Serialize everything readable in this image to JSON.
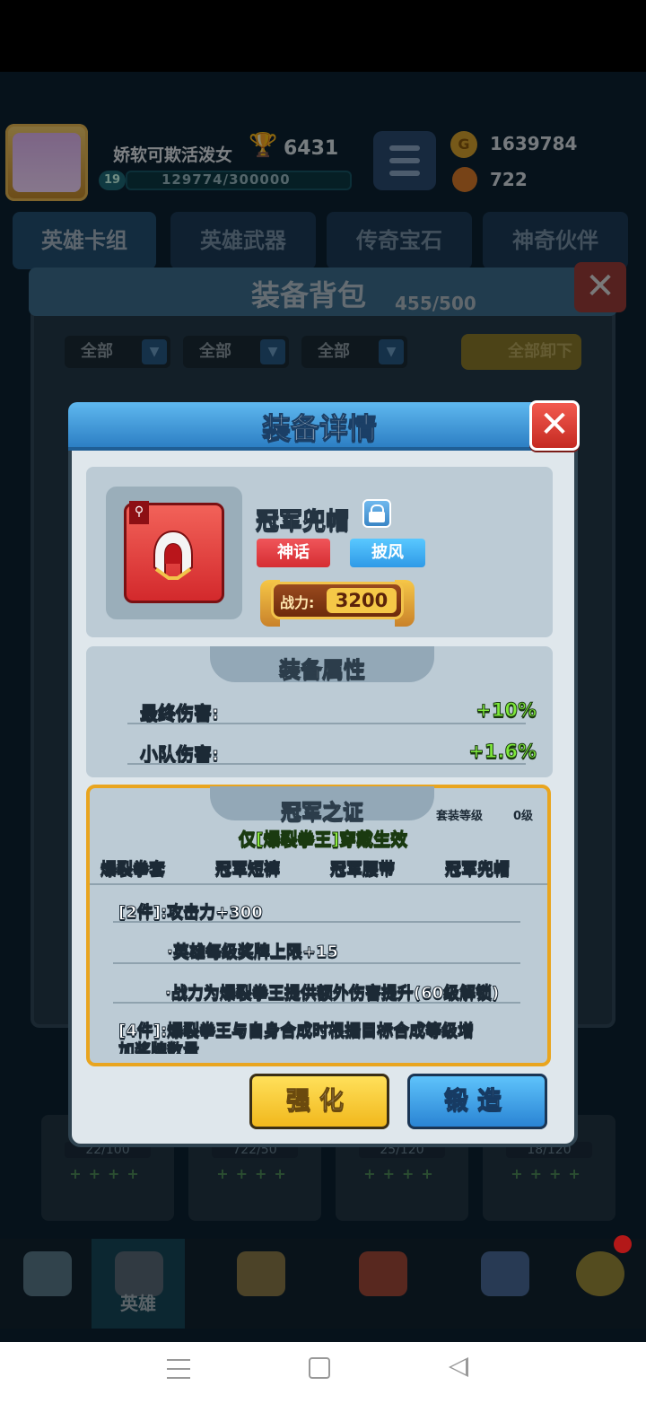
{
  "header": {
    "player_name": "娇软可欺活泼女",
    "trophies": "6431",
    "level": "19",
    "xp": "129774/300000",
    "coins": "1639784",
    "gems": "722"
  },
  "tabs": [
    {
      "label": "英雄卡组"
    },
    {
      "label": "英雄武器"
    },
    {
      "label": "传奇宝石"
    },
    {
      "label": "神奇伙伴"
    }
  ],
  "inventory": {
    "title": "装备背包",
    "count": "455/500",
    "filters": [
      "全部",
      "全部",
      "全部"
    ],
    "unequip_all": "全部卸下"
  },
  "cards": [
    {
      "count": "22/100"
    },
    {
      "count": "722/50"
    },
    {
      "count": "25/120"
    },
    {
      "count": "18/120"
    }
  ],
  "bottom_nav": {
    "active_label": "英雄"
  },
  "modal": {
    "title": "装备详情",
    "close": "✕",
    "item_name": "冠军兜帽",
    "rarity_tag": "神话",
    "type_tag": "披风",
    "power_label": "战力:",
    "power_value": "3200",
    "attr_title": "装备属性",
    "attributes": [
      {
        "label": "最终伤害:",
        "value": "+10%"
      },
      {
        "label": "小队伤害:",
        "value": "+1.6%"
      }
    ],
    "set": {
      "title": "冠军之证",
      "level_label": "套装等级",
      "level_value": "0级",
      "condition": "仅[爆裂拳王]穿戴生效",
      "pieces": [
        "爆裂拳套",
        "冠军短裤",
        "冠军腰带",
        "冠军兜帽"
      ],
      "bonuses": [
        "[2件]:攻击力+300",
        "·英雄每级奖牌上限+15",
        "·战力为爆裂拳王提供额外伤害提升(60级解锁)",
        "[4件]:爆裂拳王与自身合成时根据目标合成等级增",
        "加奖牌数量"
      ]
    },
    "btn_upgrade": "强化",
    "btn_forge": "锻造"
  },
  "colors": {
    "accent_blue": "#2d7fc4",
    "mythic_red": "#d52d32",
    "bonus_green": "#7ee83b",
    "gold": "#f5c847"
  }
}
